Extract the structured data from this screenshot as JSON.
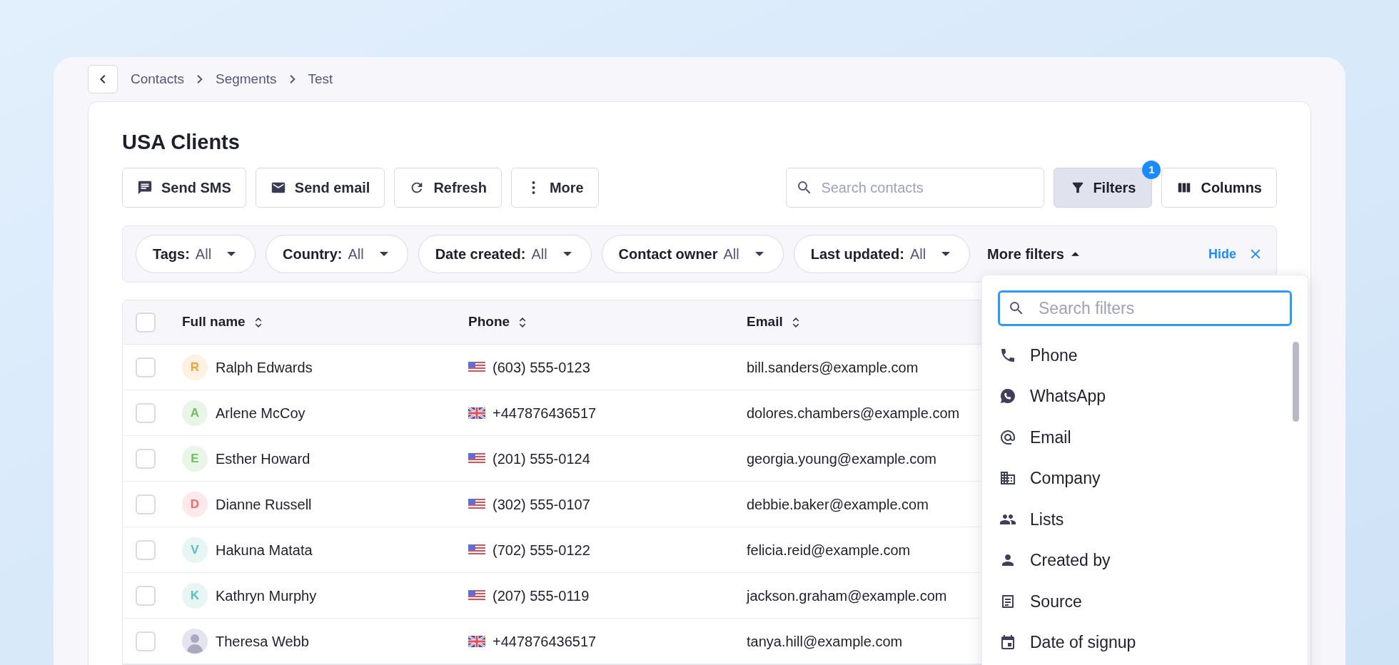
{
  "breadcrumb": [
    "Contacts",
    "Segments",
    "Test"
  ],
  "title": "USA Clients",
  "actions": [
    {
      "label": "Send SMS"
    },
    {
      "label": "Send email"
    },
    {
      "label": "Refresh"
    },
    {
      "label": "More"
    }
  ],
  "search": {
    "placeholder": "Search contacts"
  },
  "filters_button": {
    "label": "Filters",
    "badge": "1",
    "active": true
  },
  "columns_button": {
    "label": "Columns"
  },
  "filter_chips": [
    {
      "label": "Tags:",
      "value": "All"
    },
    {
      "label": "Country:",
      "value": "All"
    },
    {
      "label": "Date created:",
      "value": "All"
    },
    {
      "label": "Contact owner",
      "value": "All"
    },
    {
      "label": "Last updated:",
      "value": "All"
    }
  ],
  "more_filters": {
    "label": "More filters",
    "expanded": true
  },
  "hide_link": "Hide",
  "table": {
    "select_all": {
      "checked": false
    },
    "columns": [
      "Full name",
      "Phone",
      "Email"
    ],
    "rows": [
      {
        "checked": false,
        "avatar": {
          "kind": "letter",
          "text": "R",
          "color": "#f0a33a"
        },
        "name": "Ralph Edwards",
        "phone": {
          "kind": "us",
          "text": "(603) 555-0123"
        },
        "email": "bill.sanders@example.com"
      },
      {
        "checked": false,
        "avatar": {
          "kind": "letter",
          "text": "A",
          "color": "#6cbf5b"
        },
        "name": "Arlene McCoy",
        "phone": {
          "kind": "uk",
          "text": "+447876436517"
        },
        "email": "dolores.chambers@example.com"
      },
      {
        "checked": false,
        "avatar": {
          "kind": "letter",
          "text": "E",
          "color": "#6cbf5b"
        },
        "name": "Esther Howard",
        "phone": {
          "kind": "us",
          "text": "(201) 555-0124"
        },
        "email": "georgia.young@example.com"
      },
      {
        "checked": false,
        "avatar": {
          "kind": "letter",
          "text": "D",
          "color": "#ef6b6b"
        },
        "name": "Dianne Russell",
        "phone": {
          "kind": "us",
          "text": "(302) 555-0107"
        },
        "email": "debbie.baker@example.com"
      },
      {
        "checked": false,
        "avatar": {
          "kind": "letter",
          "text": "V",
          "color": "#5cbdbd"
        },
        "name": "Hakuna Matata",
        "phone": {
          "kind": "us",
          "text": "(702) 555-0122"
        },
        "email": "felicia.reid@example.com"
      },
      {
        "checked": false,
        "avatar": {
          "kind": "letter",
          "text": "K",
          "color": "#5cbdbd"
        },
        "name": "Kathryn Murphy",
        "phone": {
          "kind": "us",
          "text": "(207) 555-0119"
        },
        "email": "jackson.graham@example.com"
      },
      {
        "checked": false,
        "avatar": {
          "kind": "photo"
        },
        "name": "Theresa Webb",
        "phone": {
          "kind": "uk",
          "text": "+447876436517"
        },
        "email": "tanya.hill@example.com"
      }
    ]
  },
  "filter_menu": {
    "search": {
      "placeholder": "Search filters",
      "focused": true
    },
    "items": [
      {
        "label": "Phone"
      },
      {
        "label": "WhatsApp"
      },
      {
        "label": "Email"
      },
      {
        "label": "Company"
      },
      {
        "label": "Lists"
      },
      {
        "label": "Created by"
      },
      {
        "label": "Source"
      },
      {
        "label": "Date of signup"
      }
    ]
  }
}
